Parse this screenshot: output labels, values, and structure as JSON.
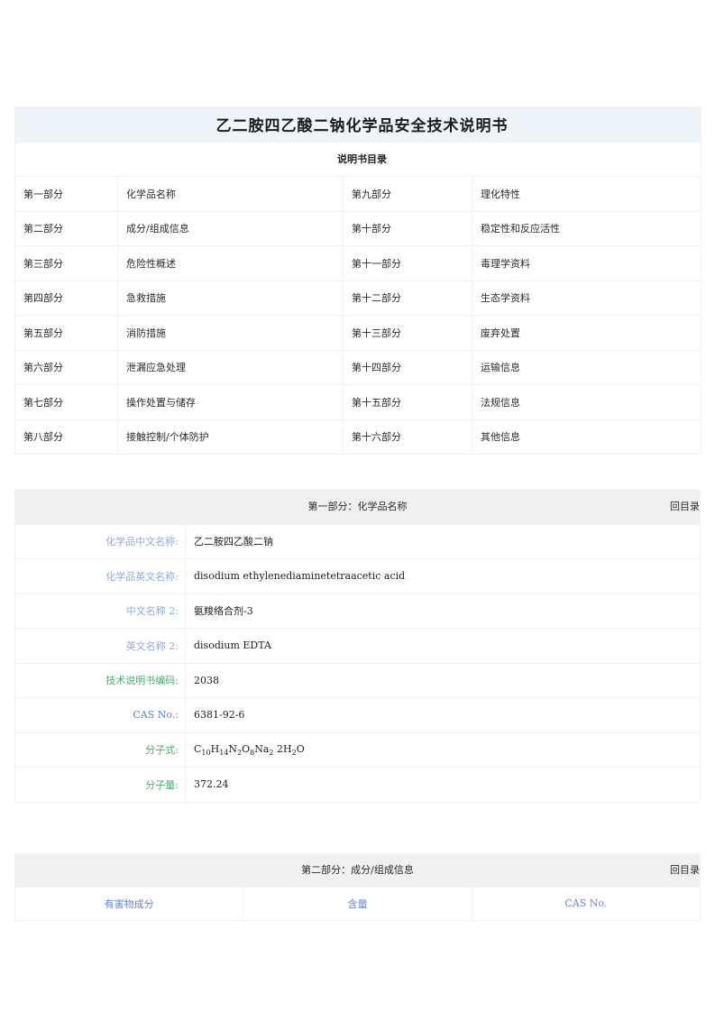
{
  "document": {
    "title": "乙二胺四乙酸二钠化学品安全技术说明书",
    "subtitle": "说明书目录",
    "back_to_toc": "回目录"
  },
  "toc": {
    "rows": [
      {
        "num_left": "第一部分",
        "name_left": "化学品名称",
        "num_right": "第九部分",
        "name_right": "理化特性"
      },
      {
        "num_left": "第二部分",
        "name_left": "成分/组成信息",
        "num_right": "第十部分",
        "name_right": "稳定性和反应活性"
      },
      {
        "num_left": "第三部分",
        "name_left": "危险性概述",
        "num_right": "第十一部分",
        "name_right": "毒理学资料"
      },
      {
        "num_left": "第四部分",
        "name_left": "急救措施",
        "num_right": "第十二部分",
        "name_right": "生态学资料"
      },
      {
        "num_left": "第五部分",
        "name_left": "消防措施",
        "num_right": "第十三部分",
        "name_right": "废弃处置"
      },
      {
        "num_left": "第六部分",
        "name_left": "泄漏应急处理",
        "num_right": "第十四部分",
        "name_right": "运输信息"
      },
      {
        "num_left": "第七部分",
        "name_left": "操作处置与储存",
        "num_right": "第十五部分",
        "name_right": "法规信息"
      },
      {
        "num_left": "第八部分",
        "name_left": "接触控制/个体防护",
        "num_right": "第十六部分",
        "name_right": "其他信息"
      }
    ]
  },
  "section_one": {
    "header": "第一部分：化学品名称",
    "rows": [
      {
        "label": "化学品中文名称:",
        "value": "乙二胺四乙酸二钠",
        "color": "blue"
      },
      {
        "label": "化学品英文名称:",
        "value": "disodium ethylenediaminetetraacetic acid",
        "color": "blue"
      },
      {
        "label": "中文名称 2:",
        "value": "氨羧络合剂-3",
        "color": "blue"
      },
      {
        "label": "英文名称 2:",
        "value": "disodium EDTA",
        "color": "blue"
      },
      {
        "label": "技术说明书编码:",
        "value": "2038",
        "color": "green"
      },
      {
        "label": "CAS No.:",
        "value": "6381-92-6",
        "color": "blue2"
      },
      {
        "label": "分子式:",
        "value": "C10H14N2O8Na2 2H2O",
        "color": "green"
      },
      {
        "label": "分子量:",
        "value": "372.24",
        "color": "green"
      }
    ]
  },
  "section_two": {
    "header": "第二部分：成分/组成信息",
    "columns": [
      "有害物成分",
      "含量",
      "CAS No."
    ]
  },
  "colors": {
    "title_bg": "#eff4f8",
    "section_bg": "#f0f0f0",
    "border": "#f2f2f2",
    "label_blue": "#8fa9df",
    "label_green": "#4dab6d",
    "label_blue_strong": "#5b7fd4",
    "column_header_blue": "#6b84d8"
  }
}
